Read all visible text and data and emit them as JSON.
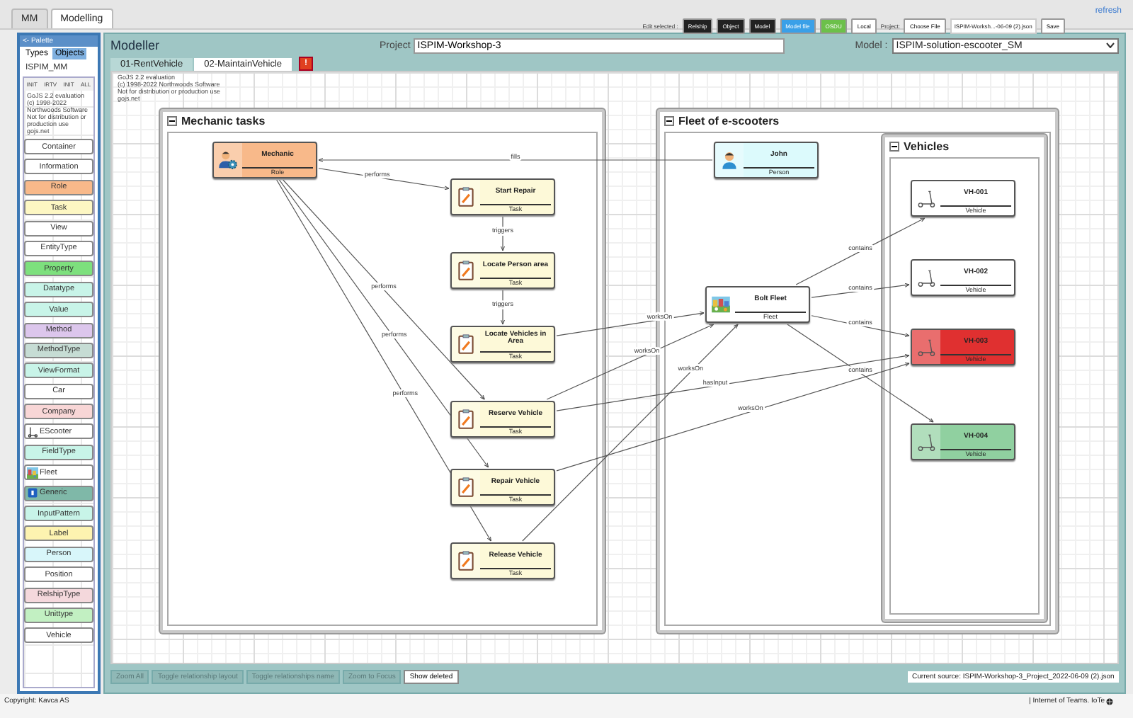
{
  "top_tabs": [
    {
      "label": "MM",
      "selected": false
    },
    {
      "label": "Modelling",
      "selected": true
    }
  ],
  "toolbar": {
    "edit_label": "Edit selected :",
    "buttons": [
      {
        "label": "Relship",
        "kind": "dark"
      },
      {
        "label": "Object",
        "kind": "dark"
      },
      {
        "label": "Model",
        "kind": "dark"
      },
      {
        "label": "Model file",
        "kind": "blue"
      },
      {
        "label": "OSDU",
        "kind": "green"
      },
      {
        "label": "Local",
        "kind": "light"
      }
    ],
    "project_label": "Project:",
    "choose_file": "Choose File",
    "file_name": "ISPIM-Worksh...-06-09 (2).json",
    "save": "Save"
  },
  "refresh": "refresh",
  "palette": {
    "title": "<- Palette",
    "tabs": [
      {
        "label": "Types",
        "selected": true
      },
      {
        "label": "Objects",
        "selected": false
      }
    ],
    "metamodel": "ISPIM_MM",
    "buttons": [
      "INIT",
      "IRTV",
      "INIT",
      "ALL"
    ],
    "notice": [
      "GoJS 2.2 evaluation",
      "(c) 1998-2022 Northwoods Software",
      "Not for distribution or production use",
      "gojs.net"
    ],
    "items": [
      {
        "label": "Container",
        "color": "#ffffff",
        "kind": "plain"
      },
      {
        "label": "Information",
        "color": "#ffffff",
        "kind": "plain"
      },
      {
        "label": "Role",
        "color": "#f8b98a",
        "kind": "plain"
      },
      {
        "label": "Task",
        "color": "#fdf7c3",
        "kind": "plain"
      },
      {
        "label": "View",
        "color": "#ffffff",
        "kind": "plain"
      },
      {
        "label": "EntityType",
        "color": "#ffffff",
        "kind": "plain"
      },
      {
        "label": "Property",
        "color": "#7de07d",
        "kind": "plain"
      },
      {
        "label": "Datatype",
        "color": "#c8f4e8",
        "kind": "plain"
      },
      {
        "label": "Value",
        "color": "#c8f4e8",
        "kind": "plain"
      },
      {
        "label": "Method",
        "color": "#dcc6ec",
        "kind": "plain"
      },
      {
        "label": "MethodType",
        "color": "#c6dcd4",
        "kind": "plain"
      },
      {
        "label": "ViewFormat",
        "color": "#c8f4e8",
        "kind": "plain"
      },
      {
        "label": "Car",
        "color": "#ffffff",
        "kind": "plain"
      },
      {
        "label": "Company",
        "color": "#f8d6d6",
        "kind": "plain"
      },
      {
        "label": "EScooter",
        "color": "#ffffff",
        "kind": "scooter"
      },
      {
        "label": "FieldType",
        "color": "#c8f4e8",
        "kind": "plain"
      },
      {
        "label": "Fleet",
        "color": "#ffffff",
        "kind": "picture"
      },
      {
        "label": "Generic",
        "color": "#7fb8a8",
        "kind": "badge"
      },
      {
        "label": "InputPattern",
        "color": "#c8f4e8",
        "kind": "plain"
      },
      {
        "label": "Label",
        "color": "#fdf3b0",
        "kind": "plain"
      },
      {
        "label": "Person",
        "color": "#d8f6fa",
        "kind": "plain"
      },
      {
        "label": "Position",
        "color": "#ffffff",
        "kind": "plain"
      },
      {
        "label": "RelshipType",
        "color": "#f4d8dc",
        "kind": "plain"
      },
      {
        "label": "Unittype",
        "color": "#c2f0c2",
        "kind": "plain"
      },
      {
        "label": "Vehicle",
        "color": "#ffffff",
        "kind": "plain"
      }
    ]
  },
  "modeller": {
    "title": "Modeller",
    "project_label": "Project",
    "project": "ISPIM-Workshop-3",
    "model_label": "Model :",
    "model": "ISPIM-solution-escooter_SM",
    "tabs": [
      {
        "label": "01-RentVehicle",
        "selected": false
      },
      {
        "label": "02-MaintainVehicle",
        "selected": true
      }
    ],
    "alert": "!"
  },
  "canvas": {
    "notice": [
      "GoJS 2.2 evaluation",
      "(c) 1998-2022 Northwoods Software",
      "Not for distribution or production use",
      "gojs.net"
    ],
    "groups": [
      {
        "title": "Mechanic tasks",
        "nodes": [
          {
            "name": "Mechanic",
            "type": "Role",
            "kind": "role",
            "color": "#f8b98a"
          },
          {
            "name": "Start Repair",
            "type": "Task",
            "kind": "task",
            "color": "#fdf9d8"
          },
          {
            "name": "Locate Person area",
            "type": "Task",
            "kind": "task",
            "color": "#fdf9d8"
          },
          {
            "name": "Locate Vehicles in Area",
            "type": "Task",
            "kind": "task",
            "color": "#fdf9d8"
          },
          {
            "name": "Reserve Vehicle",
            "type": "Task",
            "kind": "task",
            "color": "#fdf9d8"
          },
          {
            "name": "Repair Vehicle",
            "type": "Task",
            "kind": "task",
            "color": "#fdf9d8"
          },
          {
            "name": "Release Vehicle",
            "type": "Task",
            "kind": "task",
            "color": "#fdf9d8"
          }
        ]
      },
      {
        "title": "Fleet of e-scooters",
        "nodes": [
          {
            "name": "John",
            "type": "Person",
            "kind": "person",
            "color": "#dcfafc"
          },
          {
            "name": "Bolt Fleet",
            "type": "Fleet",
            "kind": "fleet",
            "color": "#ffffff"
          }
        ],
        "groups": [
          {
            "title": "Vehicles",
            "nodes": [
              {
                "name": "VH-001",
                "type": "Vehicle",
                "kind": "vehicle",
                "color": "#ffffff"
              },
              {
                "name": "VH-002",
                "type": "Vehicle",
                "kind": "vehicle",
                "color": "#ffffff"
              },
              {
                "name": "VH-003",
                "type": "Vehicle",
                "kind": "vehicle",
                "color": "#e03030"
              },
              {
                "name": "VH-004",
                "type": "Vehicle",
                "kind": "vehicle",
                "color": "#90d0a0"
              }
            ]
          }
        ]
      }
    ],
    "links": [
      {
        "label": "fills"
      },
      {
        "label": "performs"
      },
      {
        "label": "triggers"
      },
      {
        "label": "triggers"
      },
      {
        "label": "performs"
      },
      {
        "label": "performs"
      },
      {
        "label": "performs"
      },
      {
        "label": "worksOn"
      },
      {
        "label": "worksOn"
      },
      {
        "label": "worksOn"
      },
      {
        "label": "hasInput"
      },
      {
        "label": "worksOn"
      },
      {
        "label": "contains"
      },
      {
        "label": "contains"
      },
      {
        "label": "contains"
      },
      {
        "label": "contains"
      }
    ]
  },
  "bottom_buttons": [
    {
      "label": "Zoom All",
      "disabled": true
    },
    {
      "label": "Toggle relationship layout",
      "disabled": true
    },
    {
      "label": "Toggle relationships name",
      "disabled": true
    },
    {
      "label": "Zoom to Focus",
      "disabled": true
    },
    {
      "label": "Show deleted",
      "disabled": false
    }
  ],
  "current_source": "Current source: ISPIM-Workshop-3_Project_2022-06-09 (2).json",
  "footer": {
    "copyright": "Copyright: Kavca AS",
    "brand": "| Internet of Teams. IoTe"
  }
}
